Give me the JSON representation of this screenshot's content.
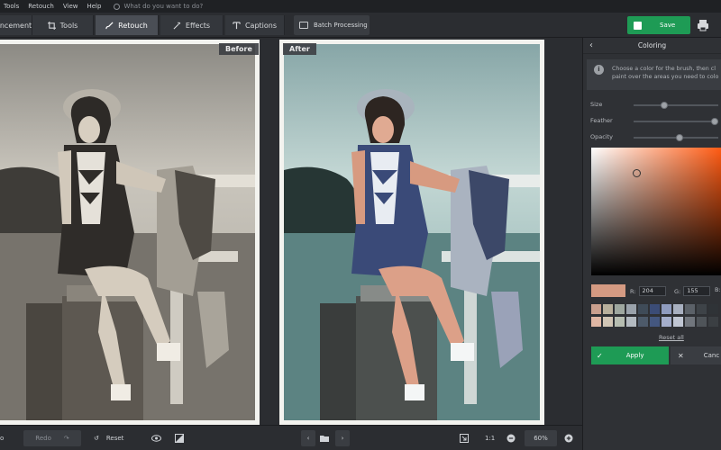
{
  "menu": {
    "items": [
      "Tools",
      "Retouch",
      "View",
      "Help"
    ],
    "search_placeholder": "What do you want to do?"
  },
  "toolbar": {
    "tabs": [
      {
        "label": "ncement",
        "icon": "enhancement-icon"
      },
      {
        "label": "Tools",
        "icon": "crop-icon"
      },
      {
        "label": "Retouch",
        "icon": "brush-icon",
        "active": true
      },
      {
        "label": "Effects",
        "icon": "magic-wand-icon"
      },
      {
        "label": "Captions",
        "icon": "text-icon"
      }
    ],
    "batch_label": "Batch Processing",
    "save_label": "Save"
  },
  "canvas": {
    "before_label": "Before",
    "after_label": "After"
  },
  "panel": {
    "title": "Coloring",
    "info_line1": "Choose a color for the brush, then cl",
    "info_line2": "paint over the areas you need to colo",
    "size_label": "Size",
    "feather_label": "Feather",
    "opacity_label": "Opacity",
    "size_value": 0.35,
    "feather_value": 1.0,
    "opacity_value": 0.55,
    "current_color": "#d49a82",
    "r_label": "R:",
    "r_value": "204",
    "g_label": "G:",
    "g_value": "155",
    "b_label": "B:",
    "palette": [
      "#caa08e",
      "#b9b09c",
      "#9ea79f",
      "#9aa2ab",
      "#3f4b58",
      "#3b4c76",
      "#8f9cbf",
      "#a8b0c0",
      "#5b6168",
      "#3e4348",
      "#2f3337",
      "#e0b7a4",
      "#d1c5b5",
      "#b6bdb1",
      "#b3bac1",
      "#4d5a6a",
      "#44577f",
      "#a4aecb",
      "#c0c6d3",
      "#71767d",
      "#4f5459",
      "#3b3f43"
    ],
    "reset_all_label": "Reset all",
    "apply_label": "Apply",
    "cancel_label": "Canc"
  },
  "bottom": {
    "undo_label": "o",
    "redo_label": "Redo",
    "reset_label": "Reset",
    "ratio_label": "1:1",
    "zoom_value": "60%"
  },
  "colors": {
    "accent_green": "#1e9b55",
    "panel_bg": "#2f3135",
    "toolbar_bg": "#2b2d31"
  }
}
